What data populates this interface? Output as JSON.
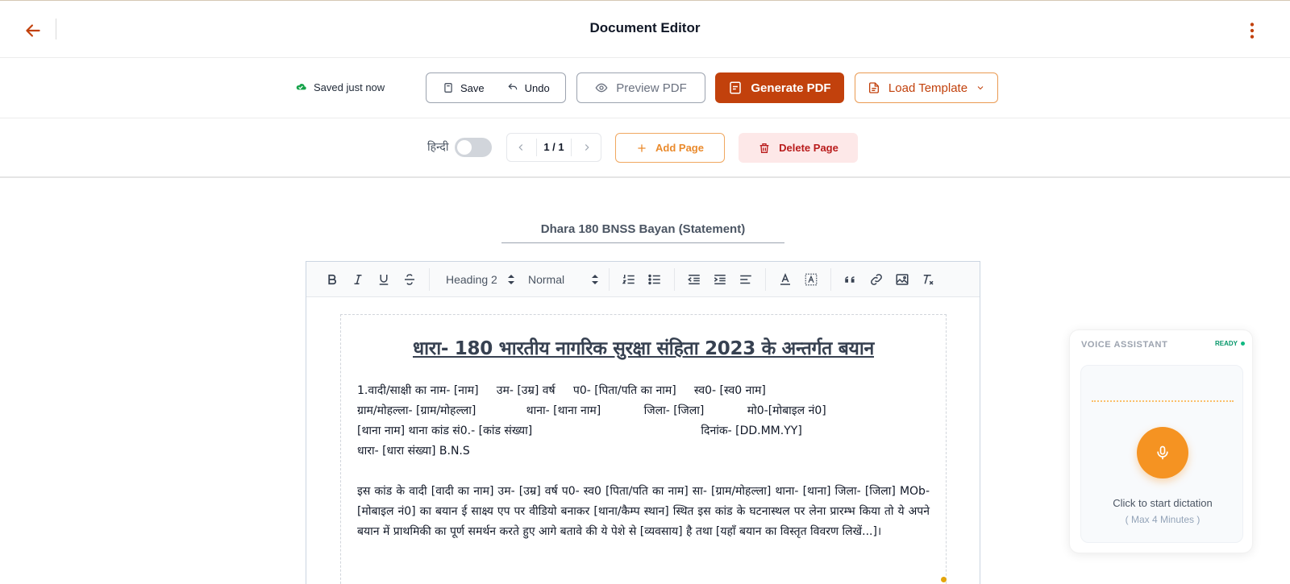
{
  "header": {
    "title": "Document Editor"
  },
  "toolbar": {
    "status": "Saved just now",
    "save_label": "Save",
    "undo_label": "Undo",
    "preview_label": "Preview PDF",
    "generate_label": "Generate PDF",
    "template_label": "Load Template"
  },
  "pages": {
    "language_label": "हिन्दी",
    "language_toggle_on": false,
    "page_indicator": "1 / 1",
    "add_label": "Add Page",
    "delete_label": "Delete Page"
  },
  "document": {
    "title": "Dhara 180 BNSS Bayan (Statement)",
    "heading": "धारा- 180 भारतीय नागरिक सुरक्षा संहिता 2023 के अन्तर्गत बयान",
    "lines": [
      "1.वादी/साक्षी का नाम- [नाम]     उम- [उम्र] वर्ष     प0- [पिता/पति का नाम]     स्व0- [स्व0 नाम]",
      "ग्राम/मोहल्ला- [ग्राम/मोहल्ला]              थाना- [थाना नाम]            जिला- [जिला]            मो0-[मोबाइल नं0]",
      "[थाना नाम] थाना कांड सं0.- [कांड संख्या]                                               दिनांक- [DD.MM.YY]",
      "धारा- [धारा संख्या] B.N.S"
    ],
    "paragraph": "इस कांड के वादी [वादी का नाम] उम- [उम्र] वर्ष प0- स्व0 [पिता/पति का नाम] सा- [ग्राम/मोहल्ला] थाना- [थाना] जिला- [जिला] MOb- [मोबाइल नं0] का बयान ई साक्ष्य एप पर वीडियो बनाकर [थाना/कैम्प स्थान] स्थित इस कांड के घटनास्थल पर लेना प्रारम्भ किया तो ये अपने बयान में प्राथमिकी का पूर्ण समर्थन करते हुए आगे बतावे की ये पेशे से [व्यवसाय] है तथा [यहाँ बयान का विस्तृत विवरण लिखें...]।"
  },
  "editor_toolbar": {
    "heading_select": "Heading 2",
    "size_select": "Normal"
  },
  "voice": {
    "title": "VOICE ASSISTANT",
    "status": "READY",
    "hint": "Click to start dictation",
    "sub": "( Max 4 Minutes )"
  },
  "colors": {
    "accent": "#c2410c",
    "accent_light": "#f59322",
    "danger_bg": "#fde8e8",
    "danger_text": "#b91c1c",
    "success": "#10b981"
  }
}
